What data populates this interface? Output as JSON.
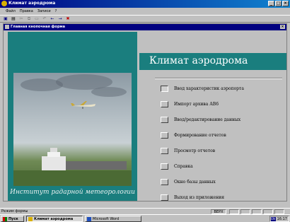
{
  "window": {
    "title": "Климат аэродрома",
    "min": "_",
    "max": "□",
    "close": "×"
  },
  "menubar": [
    "Файл",
    "Правка",
    "Записи",
    "?"
  ],
  "toolbar": {
    "icons": [
      "save-icon",
      "print-icon",
      "cut-icon",
      "copy-icon",
      "paste-icon",
      "undo-icon",
      "back-arrow-icon",
      "forward-arrow-icon",
      "stop-icon"
    ],
    "glyphs": [
      "▣",
      "▤",
      "✂",
      "⧉",
      "▭",
      "↶",
      "←",
      "→",
      "✖"
    ]
  },
  "form": {
    "title": "Главная кнопочная форма",
    "close": "×",
    "heading": "Климат аэродрома",
    "caption": "Институт радарной метеорологии",
    "colors": {
      "panel": "#1a7e7e",
      "title_bar": "#000080"
    }
  },
  "menu_items": [
    {
      "label": "Ввод характеристик аэропорта",
      "pressed": true
    },
    {
      "label": "Импорт архива АВ6",
      "pressed": false
    },
    {
      "label": "Ввод/редактирование данных",
      "pressed": false
    },
    {
      "label": "Формирование отчетов",
      "pressed": false
    },
    {
      "label": "Просмотр отчетов",
      "pressed": false
    },
    {
      "label": "Справка",
      "pressed": false
    },
    {
      "label": "Окно базы данных",
      "pressed": false
    },
    {
      "label": "Выход из приложения",
      "pressed": false
    }
  ],
  "statusbar": {
    "mode": "Режим формы",
    "indicator": "ВЕРХ"
  },
  "taskbar": {
    "start": "Пуск",
    "tasks": [
      "Климат аэродрома",
      "Microsoft Word"
    ],
    "tray_lang": "EN",
    "clock": "16:17"
  }
}
